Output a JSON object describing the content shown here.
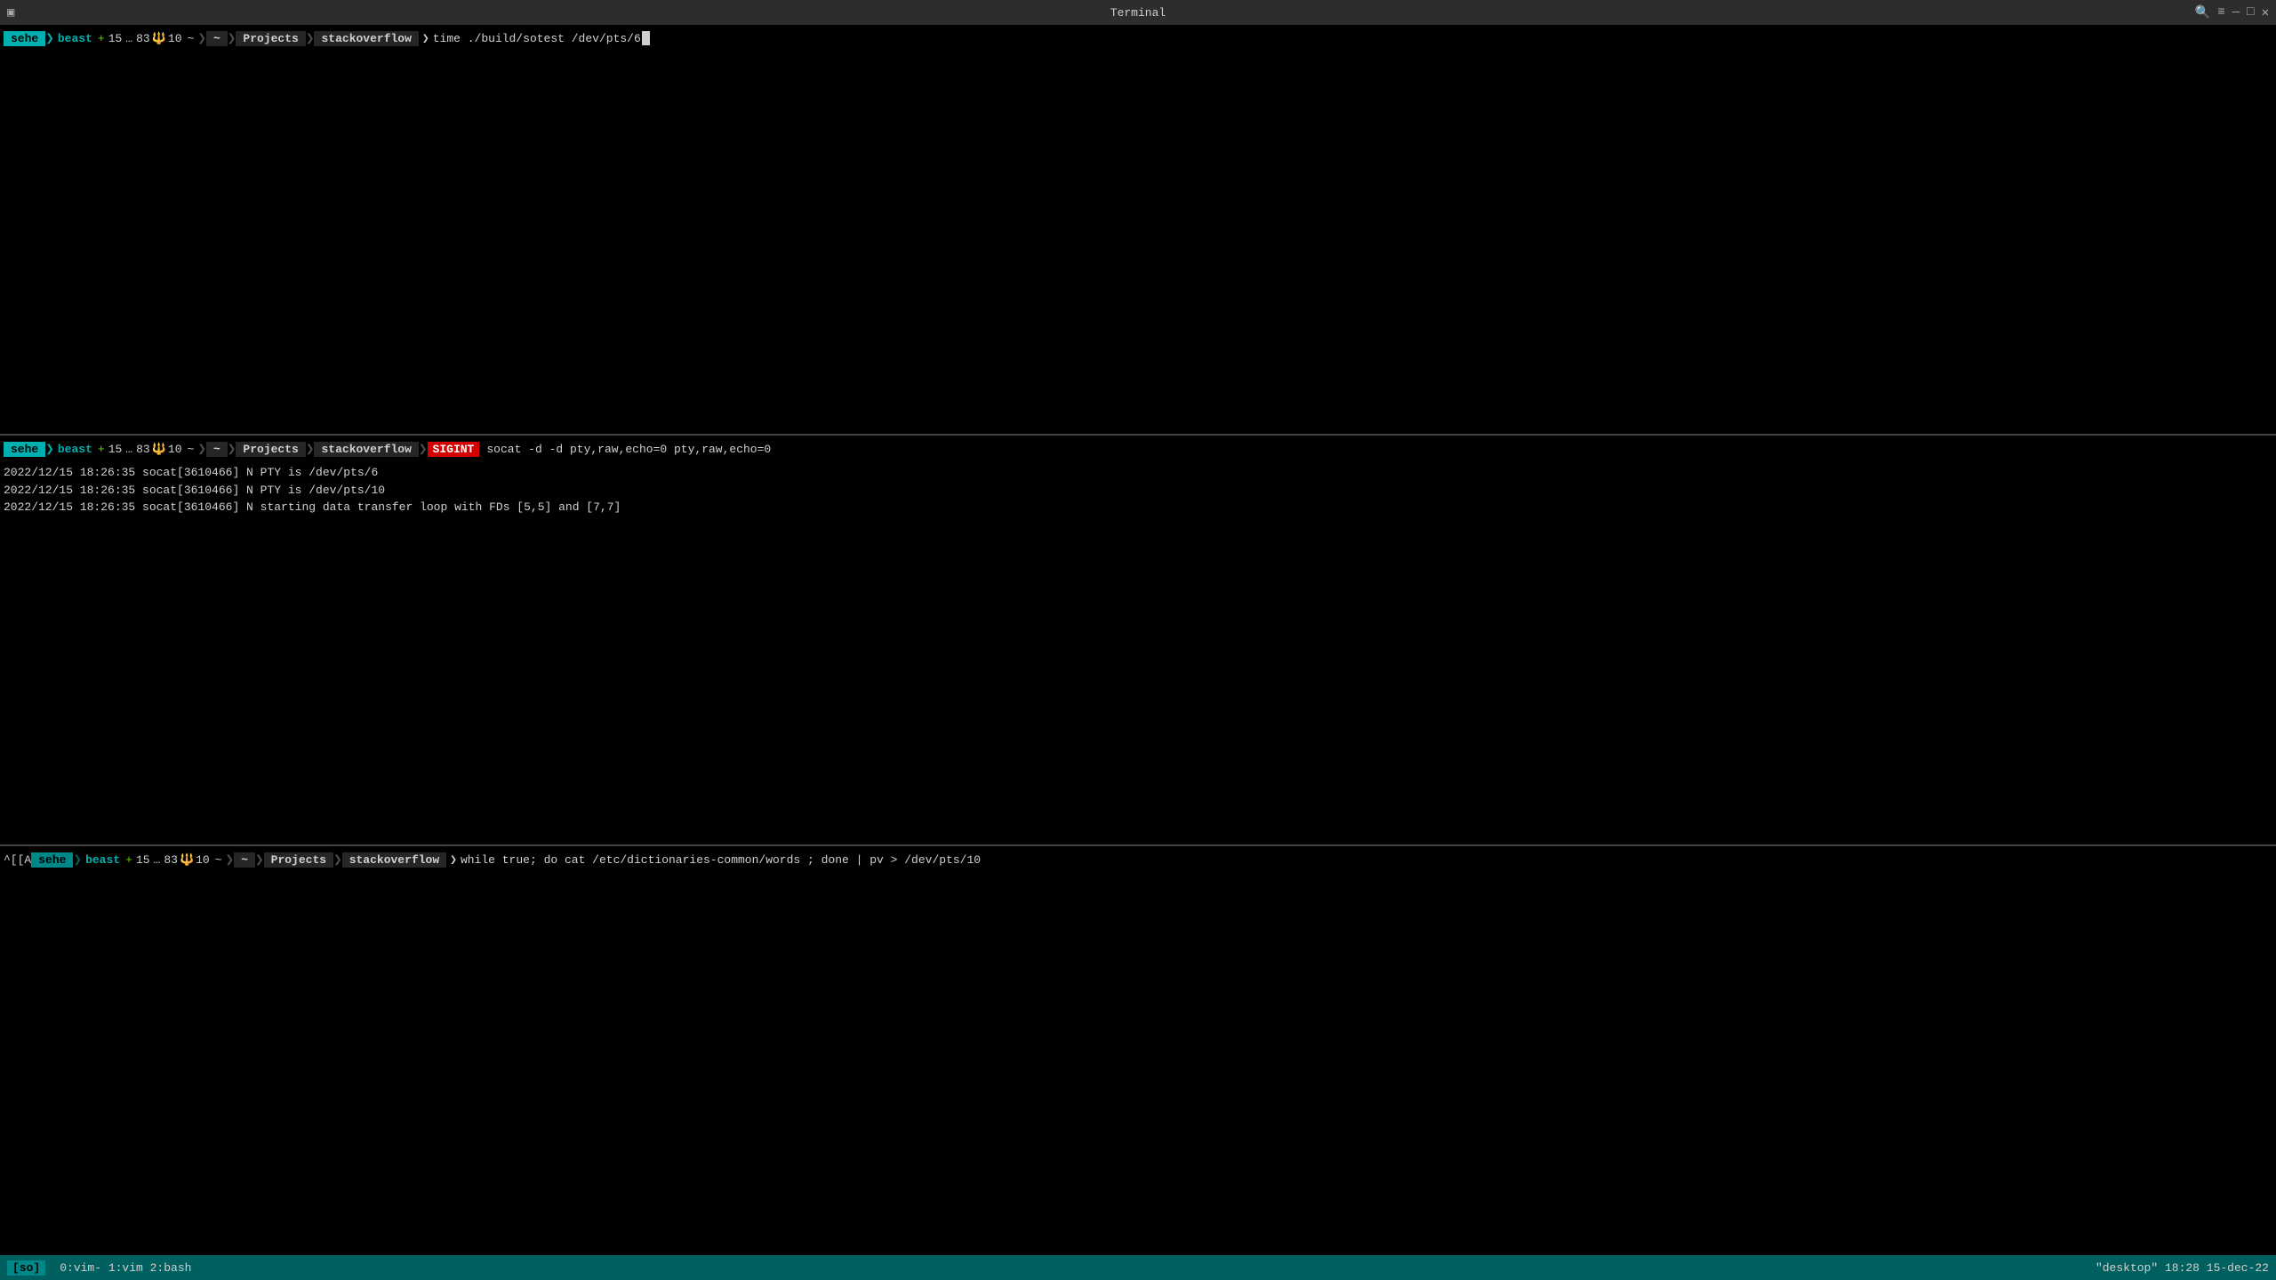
{
  "titleBar": {
    "title": "Terminal",
    "icon": "▣"
  },
  "pane1": {
    "prompt": {
      "sehe": "sehe",
      "gitIcon": "+",
      "num1": "15",
      "dots": "…",
      "num2": "83",
      "branchIcon": "🔱",
      "num3": "10",
      "tilde": "~",
      "pathArrow": "❯",
      "path1": "Projects",
      "path2": "stackoverflow",
      "dollar": "❯",
      "command": "time ./build/sotest /dev/pts/6"
    }
  },
  "pane2": {
    "prompt": {
      "sehe": "sehe",
      "gitIcon": "+",
      "num1": "15",
      "dots": "…",
      "num2": "83",
      "branchIcon": "🔱",
      "num3": "10",
      "tilde": "~",
      "pathArrow": "❯",
      "path1": "Projects",
      "path2": "stackoverflow",
      "sigint": "SIGINT",
      "command": "socat -d -d pty,raw,echo=0 pty,raw,echo=0"
    },
    "logs": [
      "2022/12/15 18:26:35 socat[3610466] N PTY is /dev/pts/6",
      "2022/12/15 18:26:35 socat[3610466] N PTY is /dev/pts/10",
      "2022/12/15 18:26:35 socat[3610466] N starting data transfer loop with FDs [5,5] and [7,7]"
    ]
  },
  "pane3": {
    "ctrlA": "^[[A",
    "prompt": {
      "sehe": "sehe",
      "gitIcon": "+",
      "num1": "15",
      "dots": "…",
      "num2": "83",
      "branchIcon": "🔱",
      "num3": "10",
      "tilde": "~",
      "pathArrow": "❯",
      "path1": "Projects",
      "path2": "stackoverflow",
      "dollar": "❯",
      "command": "while true; do cat /etc/dictionaries-common/words ; done | pv > /dev/pts/10"
    }
  },
  "statusBar": {
    "vimBadge": "[so]",
    "tabs": "0:vim-  1:vim  2:bash",
    "right": "\"desktop\" 18:28 15-dec-22"
  },
  "beast1": "beast",
  "beast2": "beast"
}
